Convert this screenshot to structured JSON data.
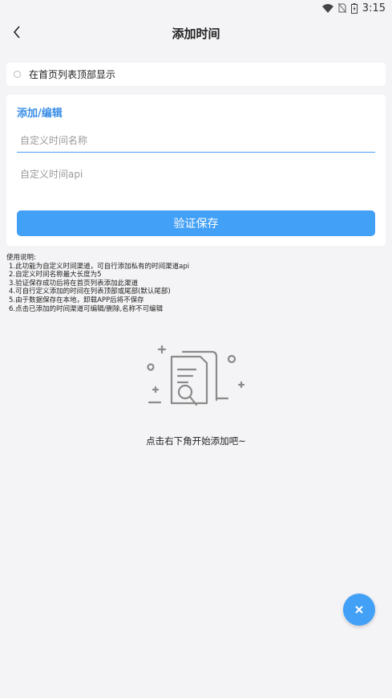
{
  "status_bar": {
    "time": "3:15"
  },
  "header": {
    "title": "添加时间"
  },
  "option": {
    "label": "在首页列表顶部显示",
    "checked": false
  },
  "form": {
    "section_title": "添加/编辑",
    "name_placeholder": "自定义时间名称",
    "api_placeholder": "自定义时间api",
    "verify_label": "验证保存"
  },
  "instructions": {
    "title": "使用说明:",
    "items": [
      "1.此功能为自定义时间渠道，可自行添加私有的时间渠道api",
      "2.自定义时间名称最大长度为5",
      "3.验证保存成功后将在首页列表添加此渠道",
      "4.可自行定义添加的时间在列表顶部或尾部(默认尾部)",
      "5.由于数据保存在本地，卸载APP后将不保存",
      "6.点击已添加的时间渠道可编辑/删除,名称不可编辑"
    ]
  },
  "empty_state": {
    "text": "点击右下角开始添加吧~"
  },
  "colors": {
    "accent": "#43a0f7",
    "title_blue": "#3a8ee6",
    "background": "#f4f4f6"
  }
}
